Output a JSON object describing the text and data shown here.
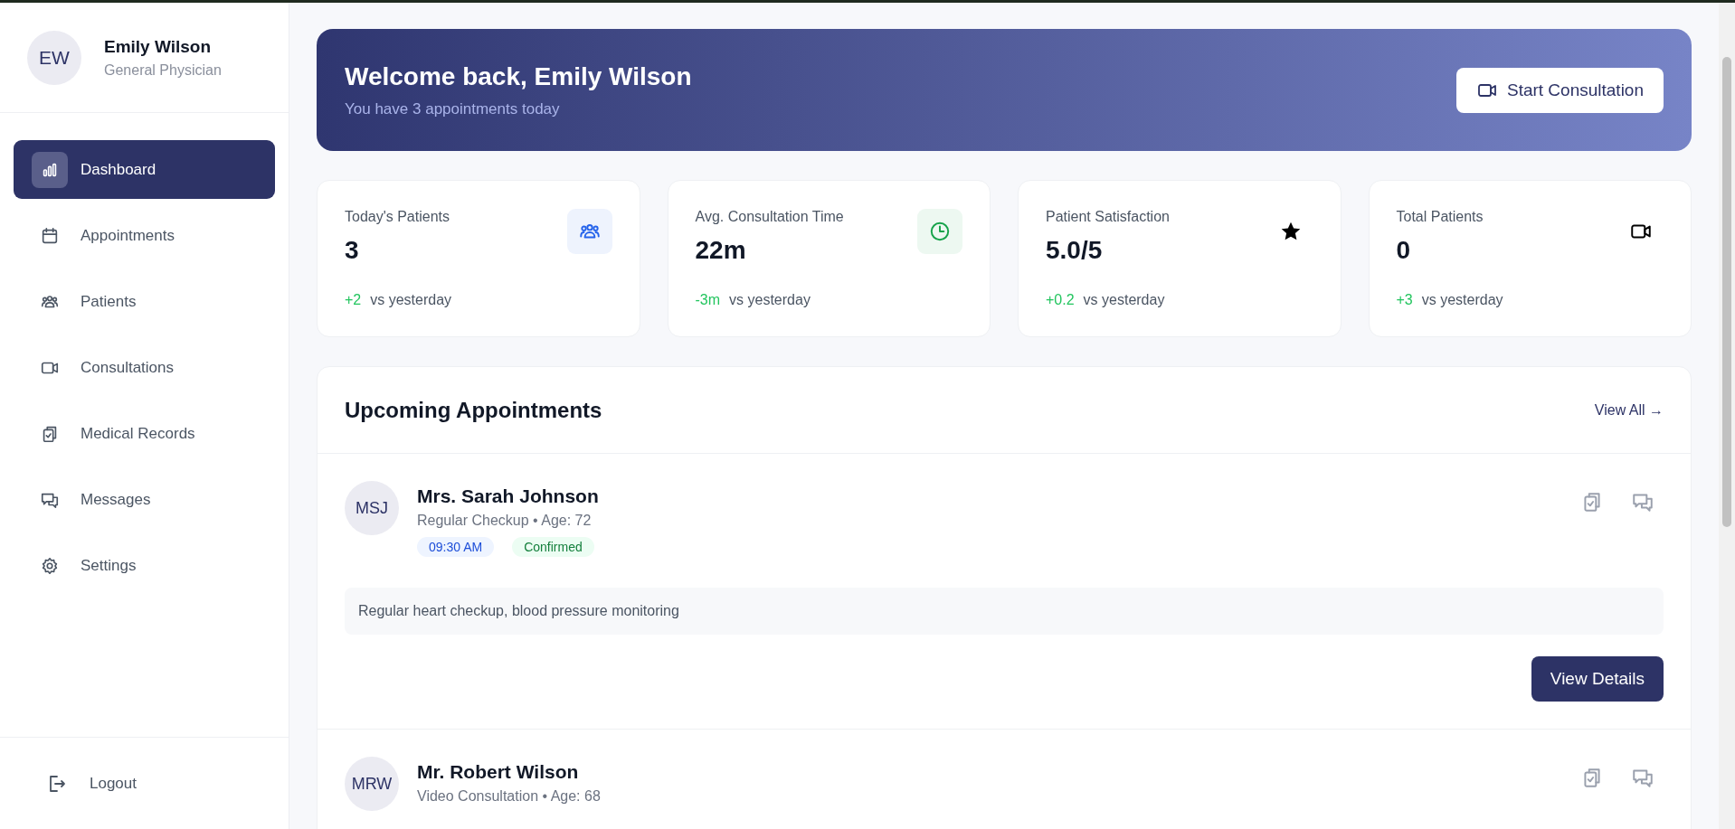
{
  "profile": {
    "initials": "EW",
    "name": "Emily Wilson",
    "role": "General Physician"
  },
  "nav": [
    {
      "label": "Dashboard",
      "selected": true
    },
    {
      "label": "Appointments",
      "selected": false
    },
    {
      "label": "Patients",
      "selected": false
    },
    {
      "label": "Consultations",
      "selected": false
    },
    {
      "label": "Medical Records",
      "selected": false
    },
    {
      "label": "Messages",
      "selected": false
    },
    {
      "label": "Settings",
      "selected": false
    }
  ],
  "logout": {
    "label": "Logout"
  },
  "banner": {
    "title": "Welcome back, Emily Wilson",
    "subtitle": "You have 3 appointments today",
    "button": "Start Consultation"
  },
  "stats": [
    {
      "label": "Today's Patients",
      "value": "3",
      "change": "+2",
      "note": "vs yesterday",
      "color": "#2563eb"
    },
    {
      "label": "Avg. Consultation Time",
      "value": "22m",
      "change": "-3m",
      "note": "vs yesterday",
      "color": "#16a34a"
    },
    {
      "label": "Patient Satisfaction",
      "value": "5.0/5",
      "change": "+0.2",
      "note": "vs yesterday",
      "color": "#000000"
    },
    {
      "label": "Total Patients",
      "value": "0",
      "change": "+3",
      "note": "vs yesterday",
      "color": "#000000"
    }
  ],
  "appointments": {
    "title": "Upcoming Appointments",
    "view_all": "View All →",
    "items": [
      {
        "initials": "MSJ",
        "name": "Mrs. Sarah Johnson",
        "detail": "Regular Checkup • Age: 72",
        "time": "09:30 AM",
        "status": "Confirmed",
        "note": "Regular heart checkup, blood pressure monitoring",
        "button": "View Details"
      },
      {
        "initials": "MRW",
        "name": "Mr. Robert Wilson",
        "detail": "Video Consultation • Age: 68"
      }
    ]
  }
}
